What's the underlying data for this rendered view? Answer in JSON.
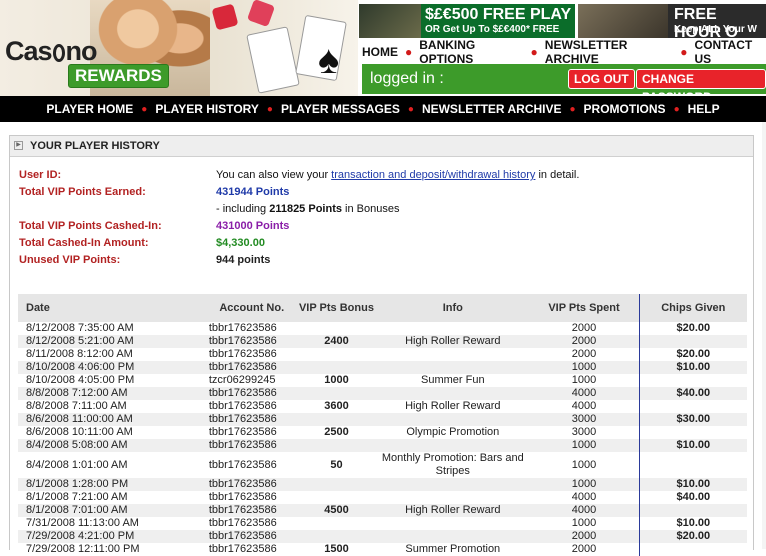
{
  "header": {
    "logo_part1": "Cas",
    "logo_part2": "no",
    "logo_rewards": "REWARDS",
    "banner1": {
      "title": "$£€500 FREE PLAY",
      "subtitle": "OR Get Up To $£€400* FREE"
    },
    "banner2": {
      "title": "FREE HOUR O",
      "subtitle": "Keep ALL Your W"
    },
    "topnav": [
      "HOME",
      "BANKING OPTIONS",
      "NEWSLETTER ARCHIVE",
      "CONTACT US"
    ],
    "logged_in_text": "logged in :",
    "logout_label": "LOG OUT",
    "change_password_label": "CHANGE PASSWORD"
  },
  "mainnav": [
    "PLAYER HOME",
    "PLAYER HISTORY",
    "PLAYER MESSAGES",
    "NEWSLETTER ARCHIVE",
    "PROMOTIONS",
    "HELP"
  ],
  "panel": {
    "title": "YOUR PLAYER HISTORY",
    "user_id_label": "User ID:",
    "user_id_pre": "You can also view your ",
    "user_id_link": "transaction and deposit/withdrawal history",
    "user_id_post": " in detail.",
    "vip_earned_label": "Total VIP Points Earned:",
    "vip_earned_value": "431944 Points",
    "bonus_pre": "- including ",
    "bonus_value": "211825 Points",
    "bonus_post": " in Bonuses",
    "cashed_label": "Total VIP Points Cashed-In:",
    "cashed_value": "431000 Points",
    "amount_label": "Total Cashed-In Amount:",
    "amount_value": "$4,330.00",
    "unused_label": "Unused VIP Points:",
    "unused_value": "944 points"
  },
  "table": {
    "headers": [
      "Date",
      "Account No.",
      "VIP Pts Bonus",
      "Info",
      "VIP Pts Spent",
      "Chips Given"
    ],
    "rows": [
      [
        "8/12/2008 7:35:00 AM",
        "tbbr17623586",
        "",
        "",
        "2000",
        "$20.00"
      ],
      [
        "8/12/2008 5:21:00 AM",
        "tbbr17623586",
        "2400",
        "High Roller Reward",
        "2000",
        ""
      ],
      [
        "8/11/2008 8:12:00 AM",
        "tbbr17623586",
        "",
        "",
        "2000",
        "$20.00"
      ],
      [
        "8/10/2008 4:06:00 PM",
        "tbbr17623586",
        "",
        "",
        "1000",
        "$10.00"
      ],
      [
        "8/10/2008 4:05:00 PM",
        "tzcr06299245",
        "1000",
        "Summer Fun",
        "1000",
        ""
      ],
      [
        "8/8/2008 7:12:00 AM",
        "tbbr17623586",
        "",
        "",
        "4000",
        "$40.00"
      ],
      [
        "8/8/2008 7:11:00 AM",
        "tbbr17623586",
        "3600",
        "High Roller Reward",
        "4000",
        ""
      ],
      [
        "8/6/2008 11:00:00 AM",
        "tbbr17623586",
        "",
        "",
        "3000",
        "$30.00"
      ],
      [
        "8/6/2008 10:11:00 AM",
        "tbbr17623586",
        "2500",
        "Olympic Promotion",
        "3000",
        ""
      ],
      [
        "8/4/2008 5:08:00 AM",
        "tbbr17623586",
        "",
        "",
        "1000",
        "$10.00"
      ],
      [
        "8/4/2008 1:01:00 AM",
        "tbbr17623586",
        "50",
        "Monthly Promotion: Bars and Stripes",
        "1000",
        ""
      ],
      [
        "8/1/2008 1:28:00 PM",
        "tbbr17623586",
        "",
        "",
        "1000",
        "$10.00"
      ],
      [
        "8/1/2008 7:21:00 AM",
        "tbbr17623586",
        "",
        "",
        "4000",
        "$40.00"
      ],
      [
        "8/1/2008 7:01:00 AM",
        "tbbr17623586",
        "4500",
        "High Roller Reward",
        "4000",
        ""
      ],
      [
        "7/31/2008 11:13:00 AM",
        "tbbr17623586",
        "",
        "",
        "1000",
        "$10.00"
      ],
      [
        "7/29/2008 4:21:00 PM",
        "tbbr17623586",
        "",
        "",
        "2000",
        "$20.00"
      ],
      [
        "7/29/2008 12:11:00 PM",
        "tbbr17623586",
        "1500",
        "Summer Promotion",
        "2000",
        ""
      ]
    ]
  }
}
